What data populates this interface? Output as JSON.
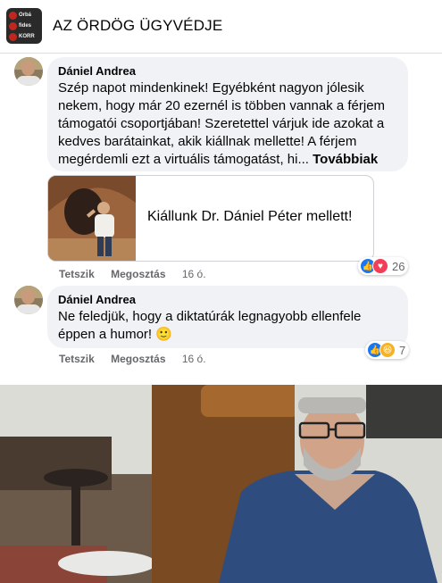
{
  "header": {
    "group_title": "AZ ÖRDÖG ÜGYVÉDJE",
    "thumb_lines": [
      "Orbá",
      "fides",
      "KORR"
    ]
  },
  "comments": [
    {
      "author": "Dániel Andrea",
      "text": "Szép napot mindenkinek! Egyébként nagyon jólesik nekem, hogy már 20 ezernél is többen vannak a férjem támogatói csoportjában! Szeretettel várjuk ide azokat a kedves barátainkat, akik kiállnak mellette! A férjem megérdemli ezt a virtuális támogatást, hi...",
      "see_more": "Továbbiak",
      "link_title": "Kiállunk Dr. Dániel Péter mellett!",
      "like_label": "Tetszik",
      "share_label": "Megosztás",
      "time": "16 ó.",
      "reaction_count": "26",
      "reaction_icons": [
        "like-icon",
        "love-icon"
      ]
    },
    {
      "author": "Dániel Andrea",
      "text": "Ne feledjük, hogy a diktatúrák legnagyobb ellenfele éppen a humor! 🙂",
      "like_label": "Tetszik",
      "share_label": "Megosztás",
      "time": "16 ó.",
      "reaction_count": "7",
      "reaction_icons": [
        "like-icon",
        "haha-icon"
      ]
    }
  ],
  "colors": {
    "bubble": "#f0f2f5",
    "like": "#1877f2",
    "love": "#f33e58",
    "haha": "#f7b125",
    "meta": "#65676b"
  }
}
